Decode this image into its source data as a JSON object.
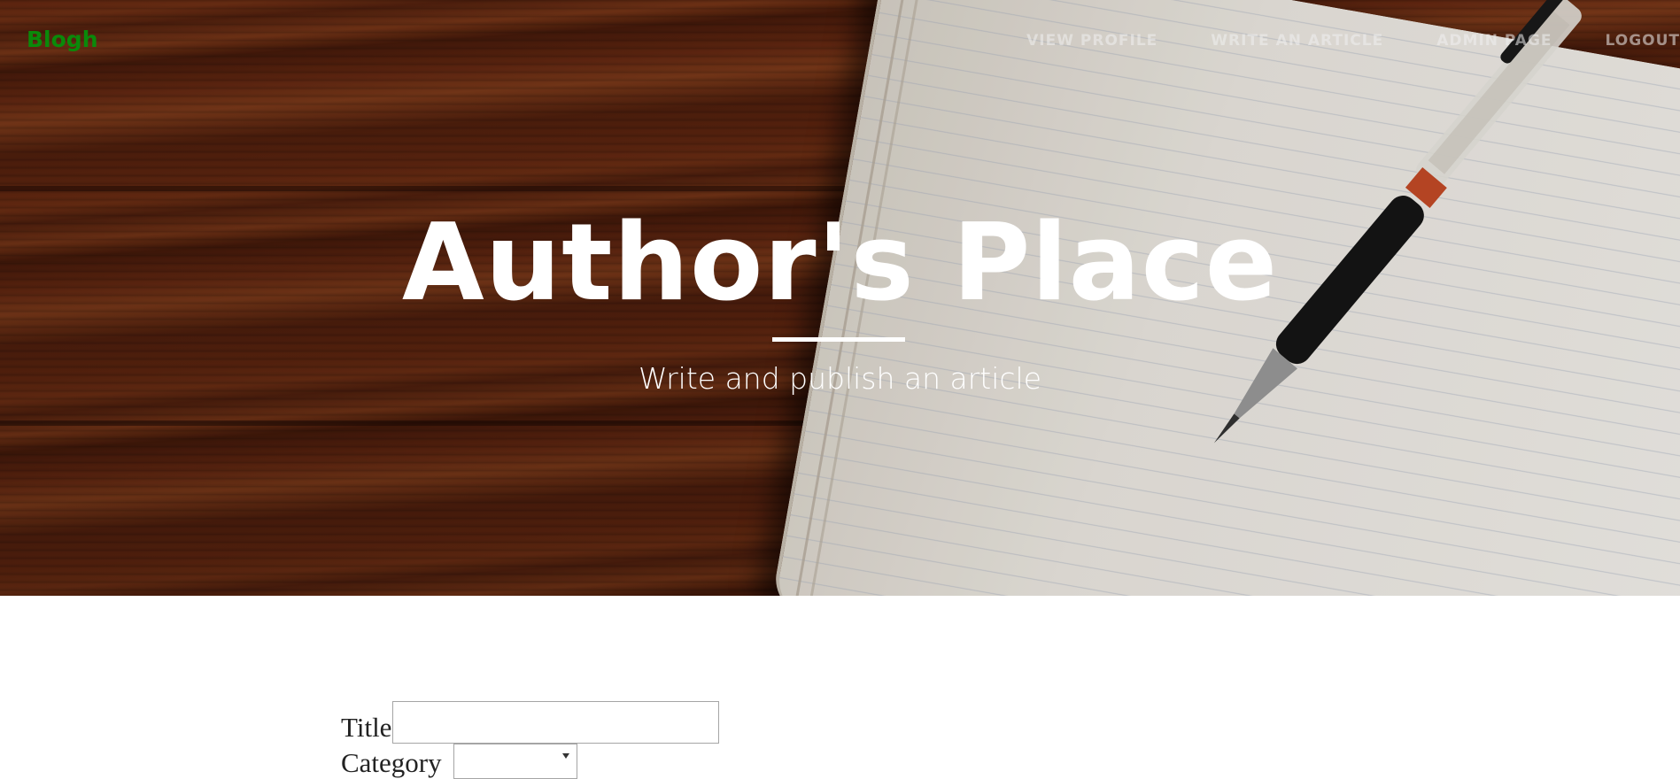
{
  "nav": {
    "brand": "Blogh",
    "links": [
      {
        "label": "VIEW PROFILE"
      },
      {
        "label": "WRITE AN ARTICLE"
      },
      {
        "label": "ADMIN PAGE"
      },
      {
        "label": "LOGOUT"
      }
    ]
  },
  "hero": {
    "title": "Author's Place",
    "subtitle": "Write and publish an article"
  },
  "form": {
    "title_label": "Title",
    "title_value": "",
    "category_label": "Category",
    "category_value": ""
  },
  "colors": {
    "brand": "#0a8a0a",
    "nav_text": "#f0f0f0",
    "hero_text": "#ffffff"
  }
}
